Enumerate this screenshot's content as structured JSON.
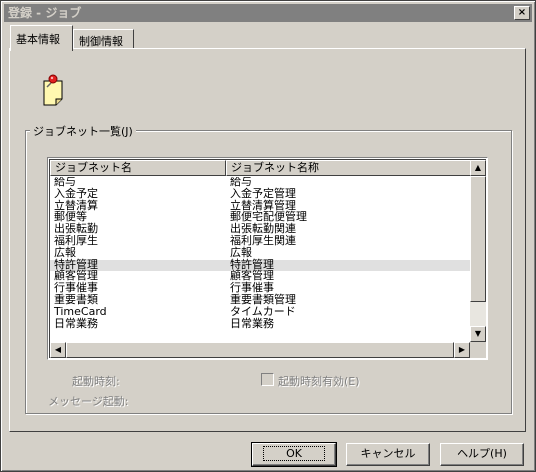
{
  "window": {
    "title": "登録 - ジョブ",
    "close_label": "×"
  },
  "tabs": [
    {
      "label": "基本情報",
      "active": true
    },
    {
      "label": "制御情報",
      "active": false
    }
  ],
  "jobnet_group": {
    "label": "ジョブネット一覧(J)",
    "columns": [
      "ジョブネット名",
      "ジョブネット名称"
    ],
    "selected_index": 8,
    "rows": [
      {
        "name": "給与",
        "title": "給与"
      },
      {
        "name": "入金予定",
        "title": "入金予定管理"
      },
      {
        "name": "立替清算",
        "title": "立替清算管理"
      },
      {
        "name": "郵便等",
        "title": "郵便宅配便管理"
      },
      {
        "name": "出張転勤",
        "title": "出張転勤関連"
      },
      {
        "name": "福利厚生",
        "title": "福利厚生関連"
      },
      {
        "name": "広報",
        "title": "広報"
      },
      {
        "name": "特許管理",
        "title": "特許管理"
      },
      {
        "name": "顧客管理",
        "title": "顧客管理"
      },
      {
        "name": "行事催事",
        "title": "行事催事"
      },
      {
        "name": "重要書類",
        "title": "重要書類管理"
      },
      {
        "name": "TimeCard",
        "title": "タイムカード"
      },
      {
        "name": "日常業務",
        "title": "日常業務"
      }
    ]
  },
  "fields": {
    "start_time_label": "起動時刻:",
    "start_time_enabled_label": "起動時刻有効(E)",
    "message_start_label": "メッセージ起動:"
  },
  "buttons": {
    "ok": "OK",
    "cancel": "キャンセル",
    "help": "ヘルプ(H)"
  },
  "icons": {
    "task_icon": "sticky-note-with-pin-icon",
    "scroll_up": "▲",
    "scroll_down": "▼",
    "scroll_left": "◀",
    "scroll_right": "▶"
  },
  "colors": {
    "face": "#d4d0c8",
    "title_inactive": "#808080",
    "note_yellow": "#fff8b0",
    "pin_red": "#e02020"
  }
}
